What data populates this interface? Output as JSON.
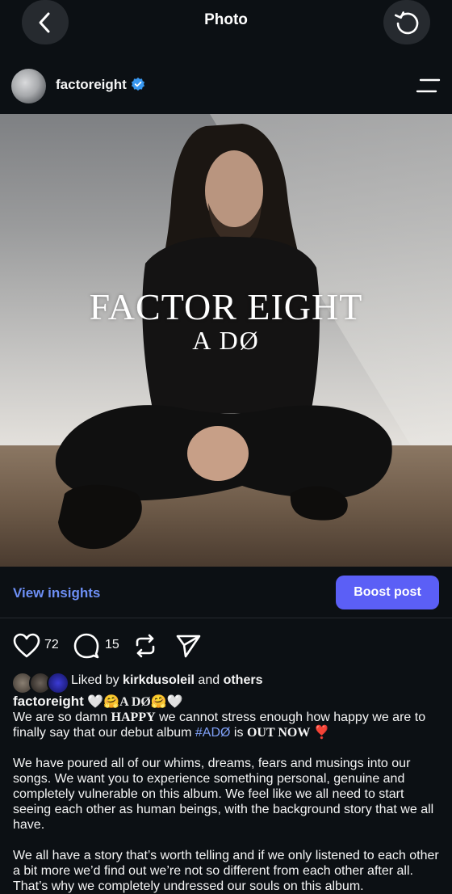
{
  "topbar": {
    "title": "Photo"
  },
  "post": {
    "username": "factoreight",
    "cover_title": "FACTOR EIGHT",
    "cover_subtitle": "A DØ"
  },
  "actions": {
    "insights_label": "View insights",
    "boost_label": "Boost post"
  },
  "engagement": {
    "likes": "72",
    "comments": "15"
  },
  "liked_by": {
    "prefix": "Liked by ",
    "user": "kirkdusoleil",
    "middle": " and ",
    "others": "others"
  },
  "caption": {
    "username": "factoreight",
    "title_emoji_text": "🤍🤗A DØ🤗🤍",
    "line1_a": "We are so damn ",
    "line1_happy": "HAPPY",
    "line1_b": " we cannot stress enough how happy we are to finally say that our debut album ",
    "hashtag": "#ADØ",
    "line1_c": " is ",
    "out_now": "OUT NOW",
    "exclaim": "❣️",
    "para2": "We have poured all of our whims, dreams, fears and musings into our songs. We want you to experience something personal, genuine and completely vulnerable on this album. We feel like we all need to start seeing each other as human beings, with the background story that we all have.",
    "para3": "We all have a story that’s worth telling and if we only listened to each other a bit more we’d find out we’re not so different from each other after all. That’s why we completely undressed our souls on this album."
  },
  "colors": {
    "accent": "#5b5ff6",
    "link": "#6d8ff5",
    "verified": "#3897f0",
    "background": "#0c1014"
  }
}
